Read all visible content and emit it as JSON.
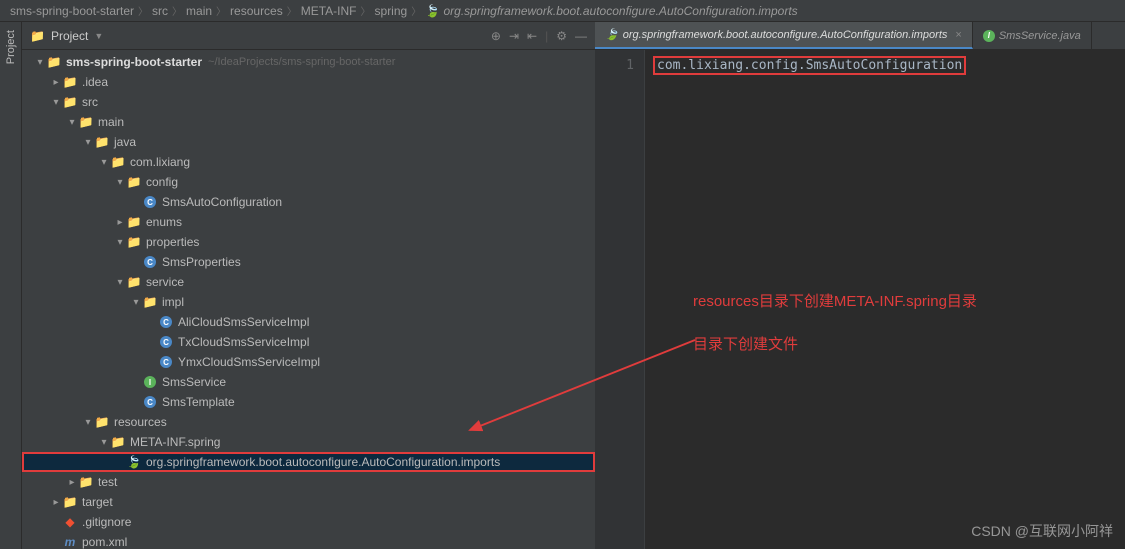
{
  "breadcrumb": [
    "sms-spring-boot-starter",
    "src",
    "main",
    "resources",
    "META-INF",
    "spring",
    "org.springframework.boot.autoconfigure.AutoConfiguration.imports"
  ],
  "sidebar_label": "Project",
  "panel": {
    "title": "Project"
  },
  "tree": [
    {
      "depth": 0,
      "arrow": "v",
      "icon": "folder",
      "label": "sms-spring-boot-starter",
      "suffix": "~/IdeaProjects/sms-spring-boot-starter",
      "bold": true
    },
    {
      "depth": 1,
      "arrow": ">",
      "icon": "folder",
      "label": ".idea"
    },
    {
      "depth": 1,
      "arrow": "v",
      "icon": "folder",
      "label": "src"
    },
    {
      "depth": 2,
      "arrow": "v",
      "icon": "folder-blue",
      "label": "main"
    },
    {
      "depth": 3,
      "arrow": "v",
      "icon": "folder-blue",
      "label": "java"
    },
    {
      "depth": 4,
      "arrow": "v",
      "icon": "package",
      "label": "com.lixiang"
    },
    {
      "depth": 5,
      "arrow": "v",
      "icon": "package",
      "label": "config"
    },
    {
      "depth": 6,
      "arrow": "",
      "icon": "class",
      "label": "SmsAutoConfiguration"
    },
    {
      "depth": 5,
      "arrow": ">",
      "icon": "package",
      "label": "enums"
    },
    {
      "depth": 5,
      "arrow": "v",
      "icon": "package",
      "label": "properties"
    },
    {
      "depth": 6,
      "arrow": "",
      "icon": "class",
      "label": "SmsProperties"
    },
    {
      "depth": 5,
      "arrow": "v",
      "icon": "package",
      "label": "service"
    },
    {
      "depth": 6,
      "arrow": "v",
      "icon": "package",
      "label": "impl"
    },
    {
      "depth": 7,
      "arrow": "",
      "icon": "class",
      "label": "AliCloudSmsServiceImpl"
    },
    {
      "depth": 7,
      "arrow": "",
      "icon": "class",
      "label": "TxCloudSmsServiceImpl"
    },
    {
      "depth": 7,
      "arrow": "",
      "icon": "class",
      "label": "YmxCloudSmsServiceImpl"
    },
    {
      "depth": 6,
      "arrow": "",
      "icon": "interface",
      "label": "SmsService"
    },
    {
      "depth": 6,
      "arrow": "",
      "icon": "class",
      "label": "SmsTemplate"
    },
    {
      "depth": 3,
      "arrow": "v",
      "icon": "folder-res",
      "label": "resources"
    },
    {
      "depth": 4,
      "arrow": "v",
      "icon": "folder",
      "label": "META-INF.spring"
    },
    {
      "depth": 5,
      "arrow": "",
      "icon": "spring",
      "label": "org.springframework.boot.autoconfigure.AutoConfiguration.imports",
      "selected": true,
      "highlighted": true
    },
    {
      "depth": 2,
      "arrow": ">",
      "icon": "folder",
      "label": "test"
    },
    {
      "depth": 1,
      "arrow": ">",
      "icon": "folder",
      "label": "target"
    },
    {
      "depth": 1,
      "arrow": "",
      "icon": "git",
      "label": ".gitignore"
    },
    {
      "depth": 1,
      "arrow": "",
      "icon": "maven",
      "label": "pom.xml"
    }
  ],
  "tabs": [
    {
      "icon": "spring",
      "label": "org.springframework.boot.autoconfigure.AutoConfiguration.imports",
      "active": true
    },
    {
      "icon": "interface",
      "label": "SmsService.java",
      "active": false
    }
  ],
  "editor": {
    "lines": [
      {
        "num": "1",
        "text": "com.lixiang.config.SmsAutoConfiguration",
        "highlighted": true
      }
    ]
  },
  "annotations": {
    "line1": "resources目录下创建META-INF.spring目录",
    "line2": "目录下创建文件"
  },
  "watermark": "CSDN @互联网小阿祥"
}
